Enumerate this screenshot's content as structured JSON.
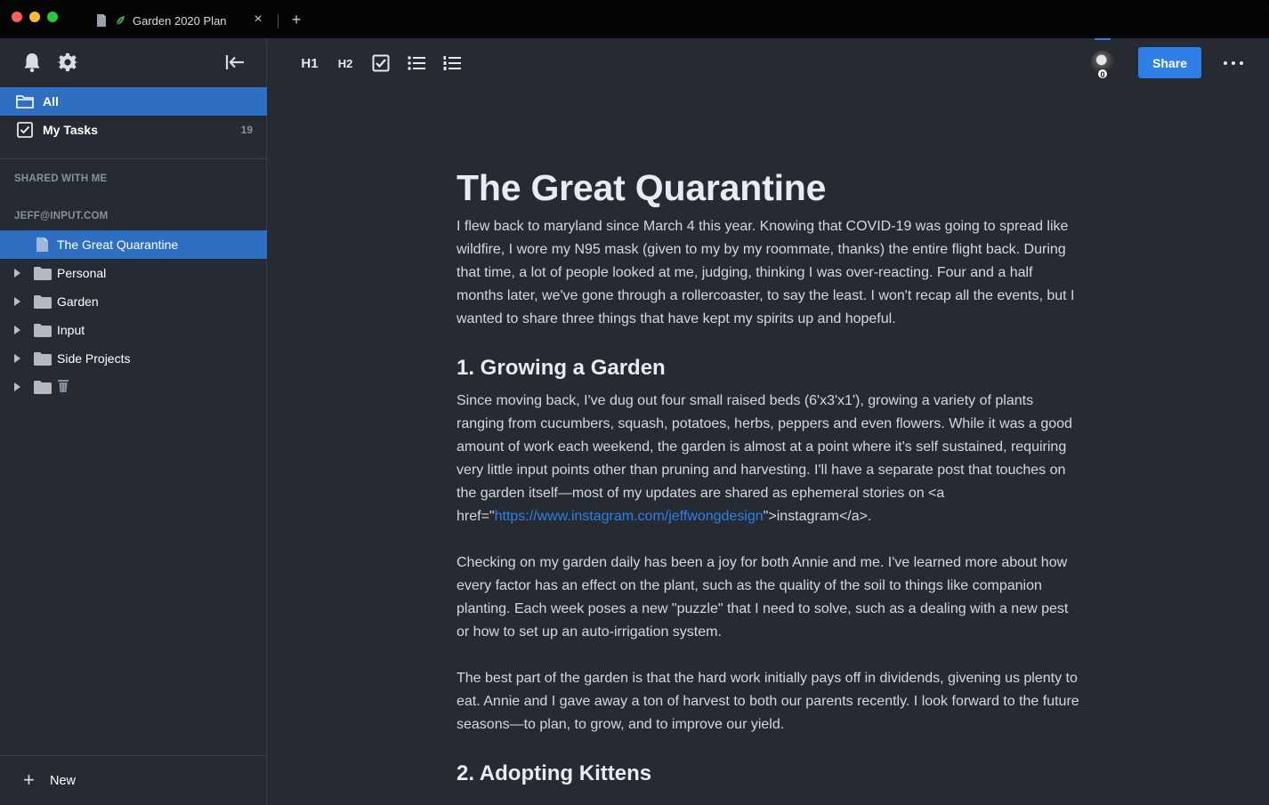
{
  "titlebar": {
    "tab_title": "Garden 2020 Plan",
    "tab_close": "×",
    "new_tab": "+"
  },
  "sidebar": {
    "nav": [
      {
        "label": "All",
        "count": ""
      },
      {
        "label": "My Tasks",
        "count": "19"
      }
    ],
    "shared_heading": "SHARED WITH ME",
    "account_heading": "JEFF@INPUT.COM",
    "tree": [
      {
        "label": "The Great Quarantine",
        "type": "doc"
      },
      {
        "label": "Personal",
        "type": "folder"
      },
      {
        "label": "Garden",
        "type": "folder"
      },
      {
        "label": "Input",
        "type": "folder"
      },
      {
        "label": "Side Projects",
        "type": "folder"
      },
      {
        "label": "",
        "type": "folder-trash"
      }
    ],
    "new_label": "New",
    "new_plus": "+"
  },
  "toolbar": {
    "h1": "H1",
    "h2": "H2",
    "share": "Share",
    "avatar_badge": "0"
  },
  "document": {
    "title": "The Great Quarantine",
    "intro": "I flew back to maryland since March 4 this year. Knowing that COVID-19 was going to spread like wildfire, I wore my N95 mask (given to my by my roommate, thanks) the entire flight back. During that time, a lot of people looked at me, judging, thinking I was over-reacting. Four and a half months later, we've gone through a rollercoaster, to say the least. I won't recap all the events, but I wanted to share three things that have kept my spirits up and hopeful.",
    "section1_heading": "1. Growing a Garden",
    "section1_p1_before": "Since moving back, I've dug out four  small raised beds (6'x3'x1'), growing a variety of plants ranging from cucumbers, squash, potatoes, herbs, peppers and even flowers. While it was a good amount of work each weekend, the garden is almost at a point where it's self sustained, requiring very little input points other than pruning and harvesting. I'll have a separate post that touches on the garden itself—most of my updates are shared as ephemeral stories on <a href=\"",
    "section1_p1_link": "https://www.instagram.com/jeffwongdesign",
    "section1_p1_after": "\">instagram</a>.",
    "section1_p2": "Checking on my garden daily has been a joy for both Annie and me. I've learned more about how every factor has an effect on the plant, such as the quality of the soil to things like companion planting. Each week poses a new \"puzzle\" that I need to solve, such as a dealing with a new pest or how to set up an auto-irrigation system.",
    "section1_p3": "The best part of the garden is that the hard work initially pays off in dividends, givening us plenty to eat. Annie and I gave away a ton of harvest to both our parents recently. I look forward to the future seasons—to plan, to grow, and to improve our yield.",
    "section2_heading": "2. Adopting Kittens"
  },
  "colors": {
    "accent": "#2f7fe6",
    "selection": "#2f6fc1",
    "background": "#262b33"
  },
  "icons": [
    "bell-icon",
    "gear-icon",
    "collapse-sidebar-icon",
    "folder-icon",
    "checkbox-icon",
    "document-icon",
    "leaf-icon",
    "trash-icon",
    "checklist-icon",
    "bullet-list-icon",
    "numbered-list-icon",
    "more-icon"
  ]
}
